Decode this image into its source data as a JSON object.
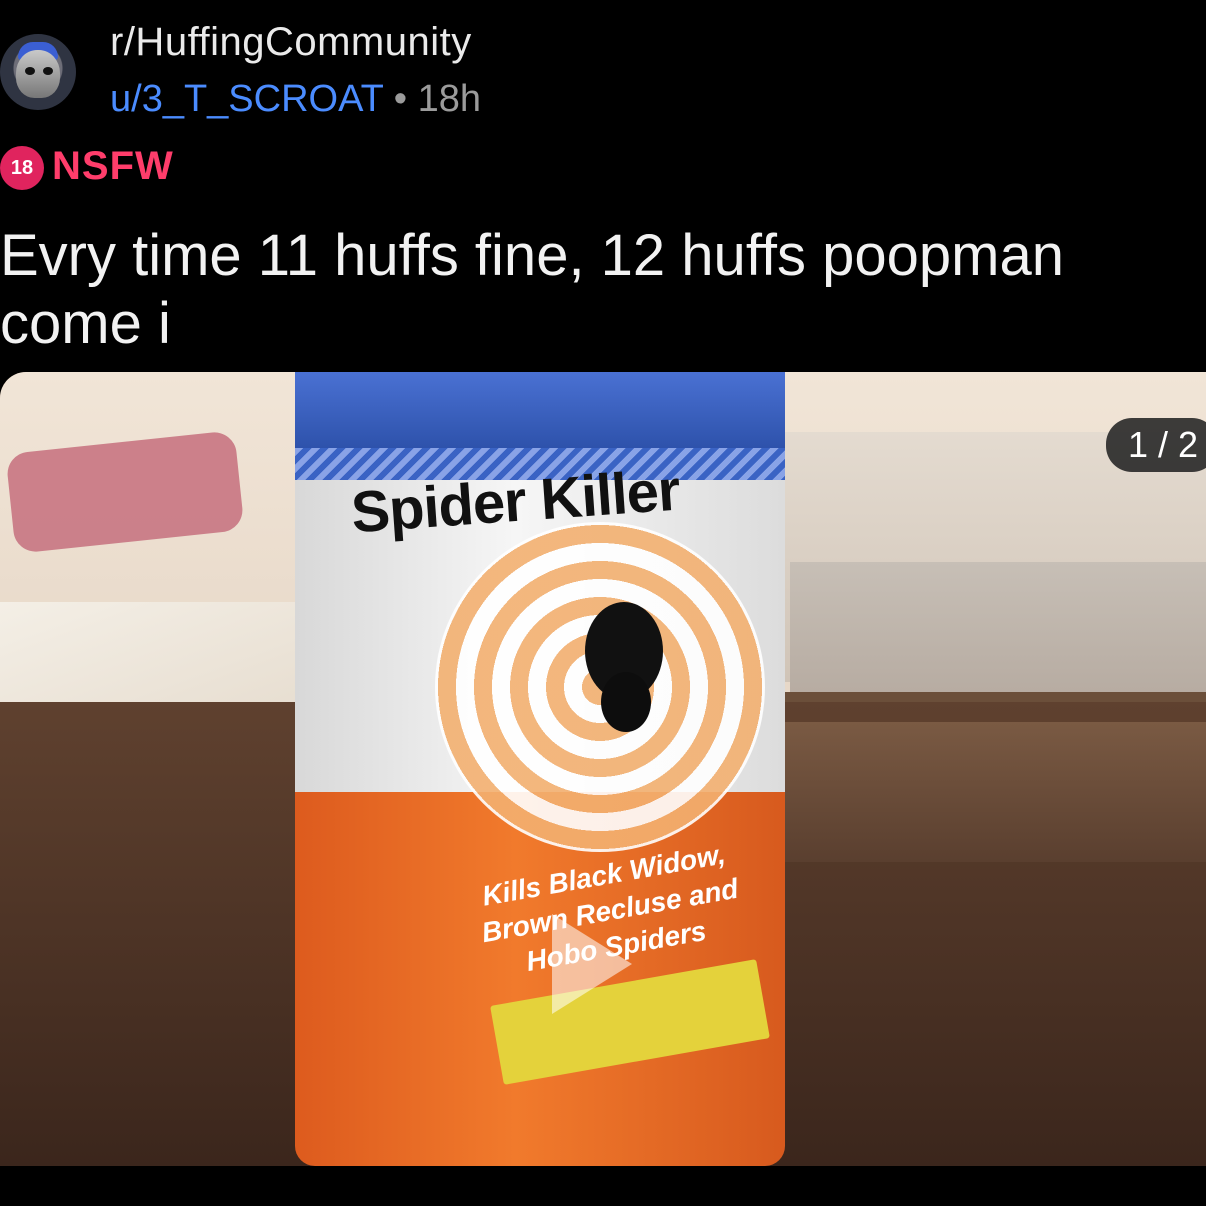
{
  "post": {
    "subreddit": "r/HuffingCommunity",
    "author": "u/3_T_SCROAT",
    "separator": "•",
    "age": "18h",
    "nsfw_badge": "18",
    "nsfw_label": "NSFW",
    "title": "Evry time 11 huffs fine, 12 huffs poopman come i"
  },
  "media": {
    "page_counter": "1 / 2",
    "product_brand_text": "Spider Killer",
    "product_claim": "Kills Black Widow, Brown Recluse and Hobo Spiders"
  },
  "icons": {
    "avatar": "avatar-icon",
    "play": "play-icon",
    "nsfw": "nsfw-badge-icon"
  },
  "colors": {
    "background": "#000000",
    "author": "#4b8cff",
    "nsfw": "#ff3d6b",
    "text": "#f2f2f2"
  }
}
